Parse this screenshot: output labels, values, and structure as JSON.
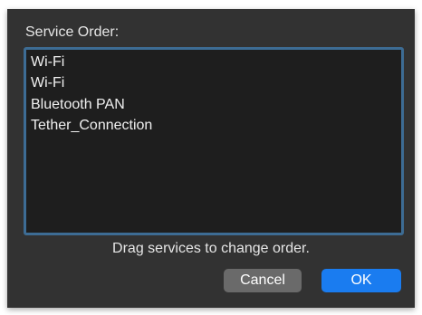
{
  "dialog": {
    "title": "Service Order:",
    "services": [
      {
        "label": "Wi-Fi"
      },
      {
        "label": "Wi-Fi"
      },
      {
        "label": "Bluetooth PAN"
      },
      {
        "label": "Tether_Connection"
      }
    ],
    "hint": "Drag services to change order.",
    "cancel_label": "Cancel",
    "ok_label": "OK"
  },
  "colors": {
    "accent": "#1a7cf0",
    "focus_ring": "#3d6c94",
    "panel_bg": "#323232",
    "list_bg": "#1e1e1e"
  }
}
